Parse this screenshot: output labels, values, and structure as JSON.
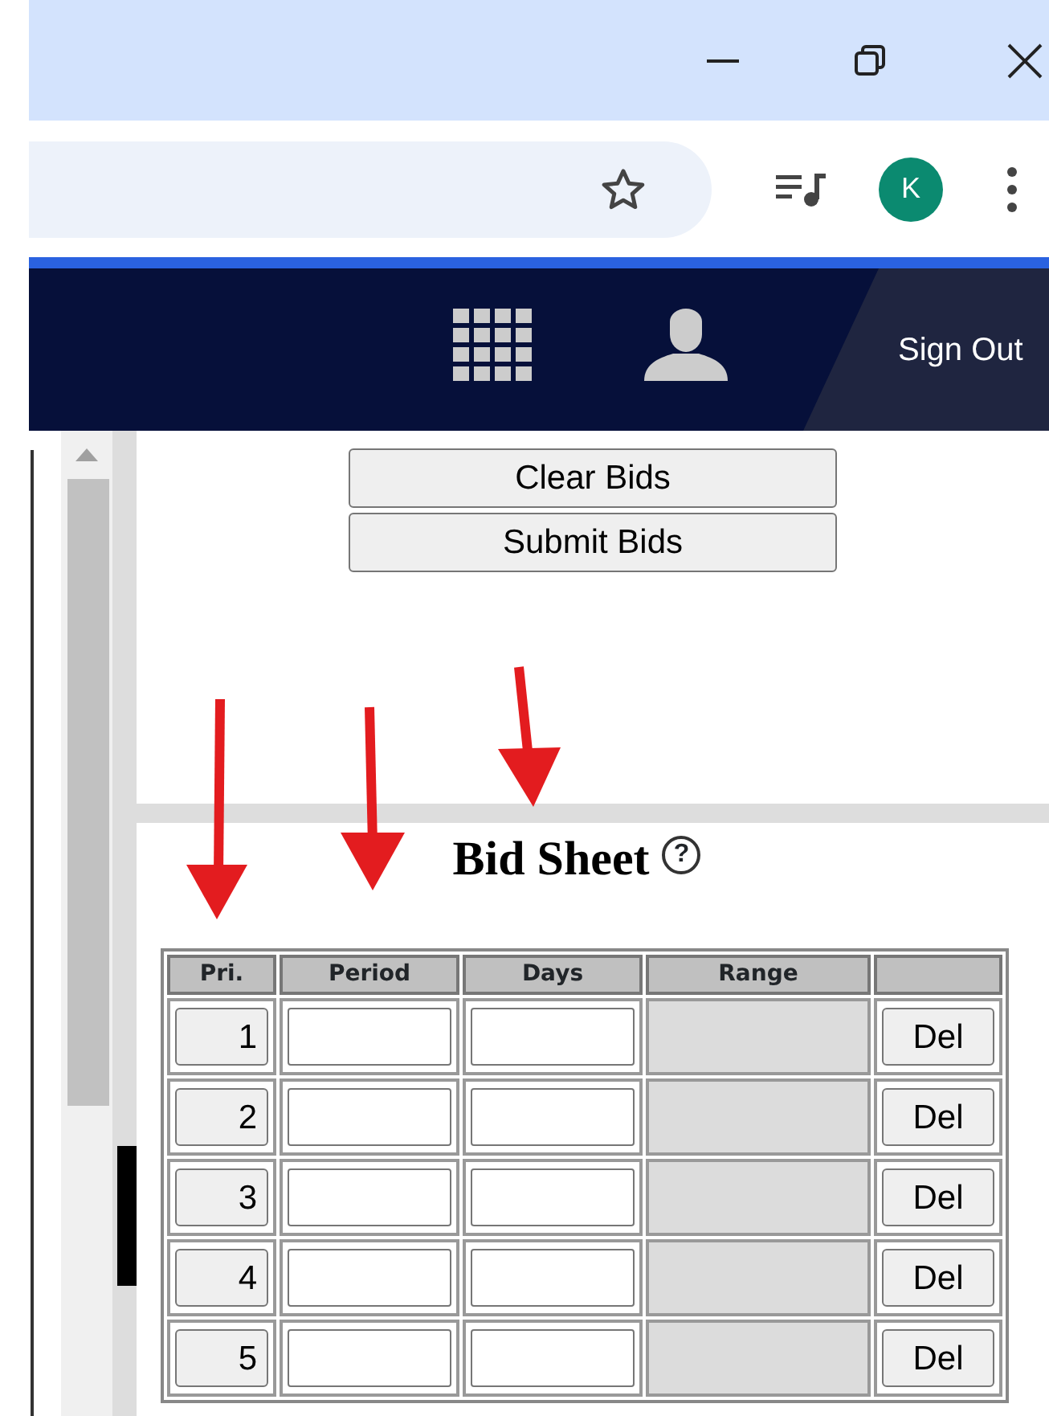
{
  "browser": {
    "profile_initial": "K"
  },
  "header": {
    "sign_out": "Sign Out"
  },
  "buttons": [
    {
      "label": "Clear Bids"
    },
    {
      "label": "Submit Bids"
    }
  ],
  "bid_sheet": {
    "title": "Bid Sheet",
    "help": "?",
    "columns": [
      "Pri.",
      "Period",
      "Days",
      "Range"
    ],
    "rows": [
      {
        "priority": "1",
        "delete": "Del"
      },
      {
        "priority": "2",
        "delete": "Del"
      },
      {
        "priority": "3",
        "delete": "Del"
      },
      {
        "priority": "4",
        "delete": "Del"
      },
      {
        "priority": "5",
        "delete": "Del"
      }
    ]
  }
}
